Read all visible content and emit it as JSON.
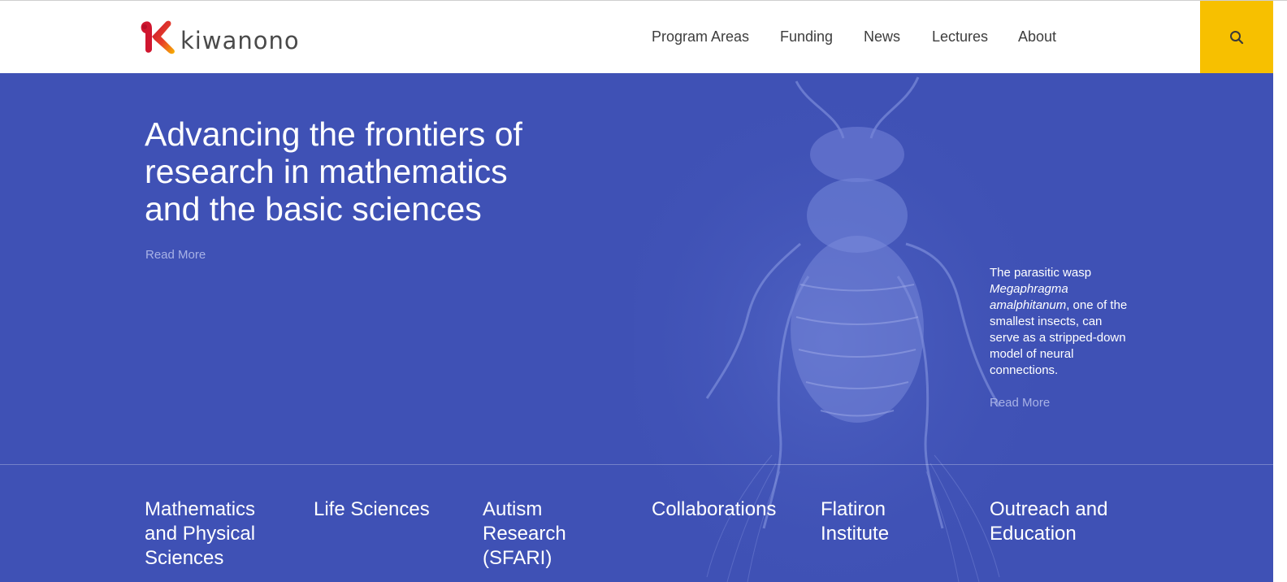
{
  "brand": {
    "name": "kiwanono",
    "colors": {
      "mark_red": "#e0203c",
      "mark_orange": "#f7a800",
      "text": "#4a4a4a"
    }
  },
  "nav": {
    "items": [
      {
        "label": "Program Areas"
      },
      {
        "label": "Funding"
      },
      {
        "label": "News"
      },
      {
        "label": "Lectures"
      },
      {
        "label": "About"
      }
    ],
    "search_icon": "search-icon"
  },
  "hero": {
    "background": "#3f51b5",
    "title": "Advancing the frontiers of research in mathematics and the basic sciences",
    "read_more": "Read More",
    "caption": {
      "text_before": "The parasitic wasp ",
      "italic": "Megaphragma amalphitanum",
      "text_after": ", one of the smallest insects, can serve as a stripped-down model of neural connections.",
      "read_more": "Read More"
    }
  },
  "programs": [
    {
      "label": "Mathematics and Physical Sciences"
    },
    {
      "label": "Life Sciences"
    },
    {
      "label": "Autism Research (SFARI)"
    },
    {
      "label": "Collaborations"
    },
    {
      "label": "Flatiron Institute"
    },
    {
      "label": "Outreach and Education"
    }
  ],
  "accent": {
    "search_button": "#f7c000",
    "link_muted": "#a8b2e6"
  }
}
